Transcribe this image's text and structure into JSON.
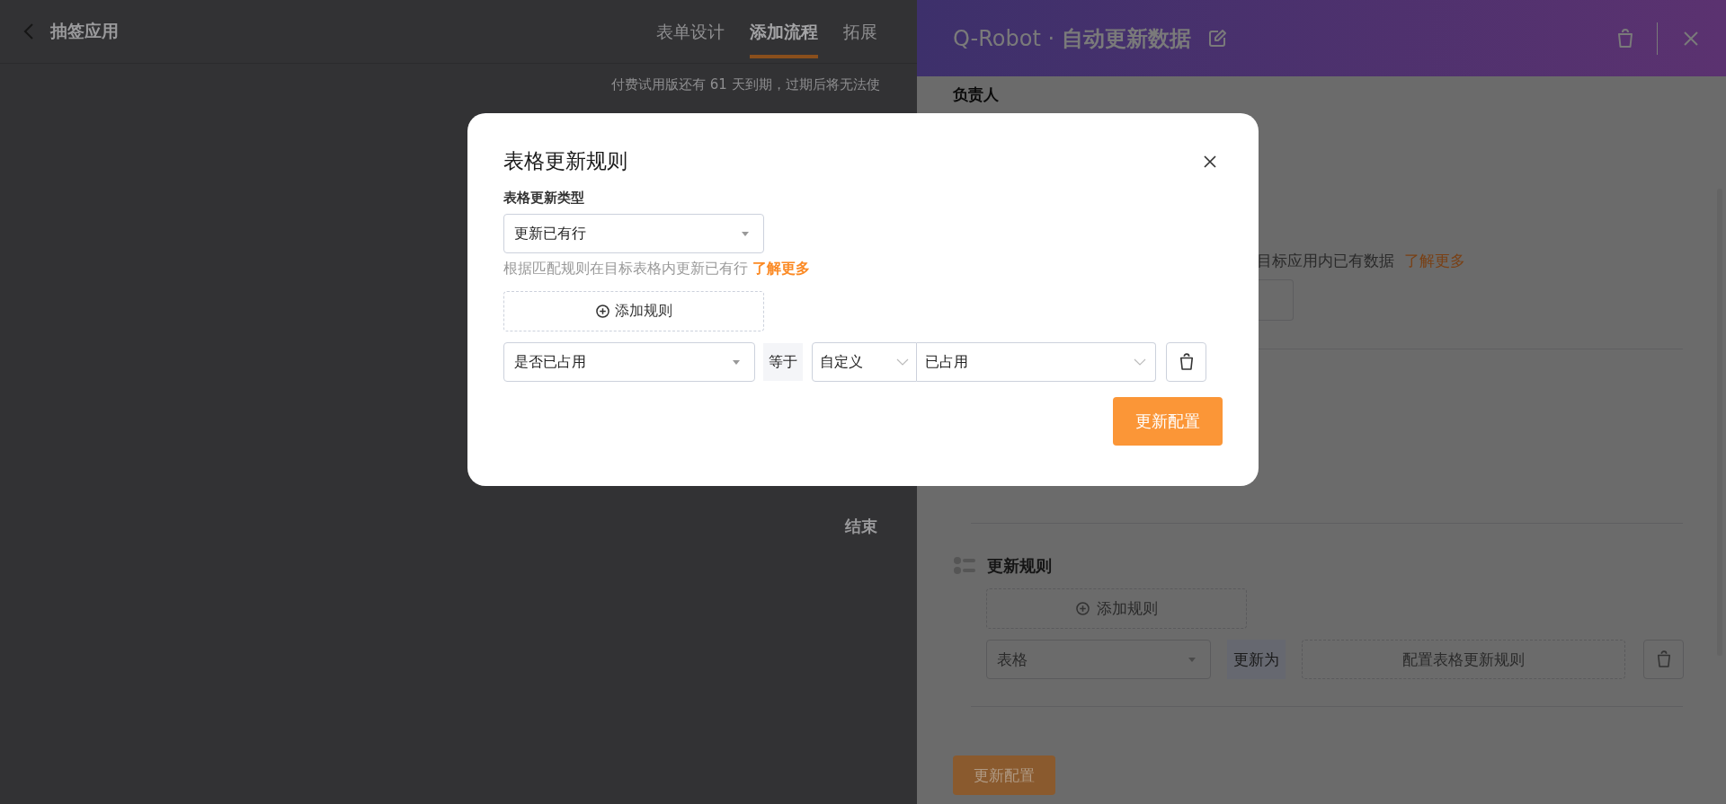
{
  "app": {
    "back_label": "抽签应用",
    "tabs": [
      {
        "label": "表单设计",
        "selected": false
      },
      {
        "label": "添加流程",
        "selected": true
      },
      {
        "label": "拓展",
        "selected": false
      }
    ],
    "notice": "付费试用版还有 61 天到期，过期后将无法使",
    "flow_end": "结束"
  },
  "drawer": {
    "title": "Q-Robot · **自动更新数据**",
    "owner_label": "负责人",
    "partial_hint": "目标应用内已有数据",
    "hint_link": "了解更多",
    "rules_title": "更新规则",
    "add_rule": "添加规则",
    "rule": {
      "field": "表格",
      "operator": "更新为",
      "action": "配置表格更新规则"
    },
    "submit": "更新配置"
  },
  "modal": {
    "title": "表格更新规则",
    "type_label": "表格更新类型",
    "type_value": "更新已有行",
    "hint": "根据匹配规则在目标表格内更新已有行",
    "hint_link": "了解更多",
    "add_rule": "添加规则",
    "conditions": [
      {
        "field": "是否已占用",
        "operator": "等于",
        "value_type": "自定义",
        "value": "已占用"
      }
    ],
    "submit": "更新配置"
  }
}
